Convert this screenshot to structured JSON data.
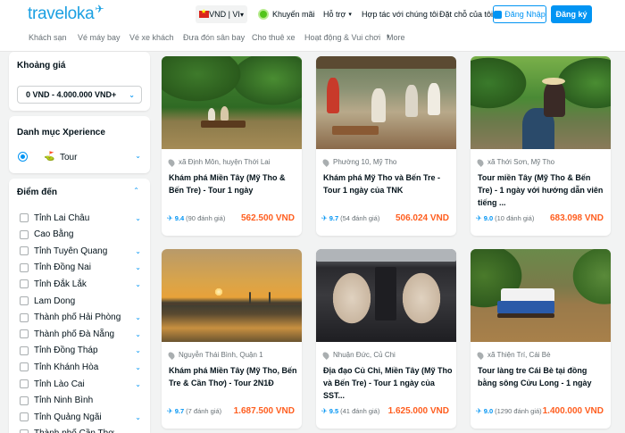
{
  "header": {
    "logo": "traveloka",
    "currency": "VND | VI",
    "promo": "Khuyến mãi",
    "support": "Hỗ trợ",
    "partner": "Hợp tác với chúng tôi",
    "bookings": "Đặt chỗ của tôi",
    "login": "Đăng Nhập",
    "register": "Đăng ký",
    "colors": {
      "brand": "#0194f3",
      "price": "#ff5e1f"
    }
  },
  "categories": [
    "Khách sạn",
    "Vé máy bay",
    "Vé xe khách",
    "Đưa đón sân bay",
    "Cho thuê xe",
    "Hoạt động & Vui chơi",
    "More"
  ],
  "sidebar": {
    "price_title": "Khoảng giá",
    "price_value": "0 VND - 4.000.000 VND+",
    "category_title": "Danh mục Xperience",
    "category_selected": "Tour",
    "dest_title": "Điểm đến",
    "destinations": [
      "Tỉnh Lai Châu",
      "Cao Bằng",
      "Tỉnh Tuyên Quang",
      "Tỉnh Đồng Nai",
      "Tỉnh Đắk Lắk",
      "Lam Dong",
      "Thành phố Hải Phòng",
      "Thành phố Đà Nẵng",
      "Tỉnh Đồng Tháp",
      "Tỉnh Khánh Hòa",
      "Tỉnh Lào Cai",
      "Tỉnh Ninh Bình",
      "Tỉnh Quảng Ngãi",
      "Thành phố Cần Thơ"
    ]
  },
  "products": [
    {
      "location": "xã Định Môn, huyện Thới Lai",
      "title": "Khám phá Miền Tây (Mỹ Tho & Bến Tre) - Tour 1 ngày",
      "score": "9.4",
      "reviews": "(90 đánh giá)",
      "price": "562.500 VND"
    },
    {
      "location": "Phường 10, Mỹ Tho",
      "title": "Khám phá Mỹ Tho và Bến Tre - Tour 1 ngày của TNK",
      "score": "9.7",
      "reviews": "(54 đánh giá)",
      "price": "506.024 VND"
    },
    {
      "location": "xã Thới Sơn, Mỹ Tho",
      "title": "Tour miền Tây (Mỹ Tho & Bến Tre) - 1 ngày với hướng dẫn viên tiếng ...",
      "score": "9.0",
      "reviews": "(10 đánh giá)",
      "price": "683.098 VND"
    },
    {
      "location": "Nguyễn Thái Bình, Quận 1",
      "title": "Khám phá Miền Tây (Mỹ Tho, Bến Tre & Cần Thơ) - Tour 2N1Đ",
      "score": "9.7",
      "reviews": "(7 đánh giá)",
      "price": "1.687.500 VND"
    },
    {
      "location": "Nhuận Đức, Củ Chi",
      "title": "Địa đạo Củ Chi, Miền Tây (Mỹ Tho và Bến Tre) - Tour 1 ngày của SST...",
      "score": "9.5",
      "reviews": "(41 đánh giá)",
      "price": "1.625.000 VND"
    },
    {
      "location": "xã Thiện Trí, Cái Bè",
      "title": "Tour làng tre Cái Bè tại đồng bằng sông Cửu Long - 1 ngày",
      "score": "9.0",
      "reviews": "(1290 đánh giá)",
      "price": "1.400.000 VND"
    }
  ]
}
